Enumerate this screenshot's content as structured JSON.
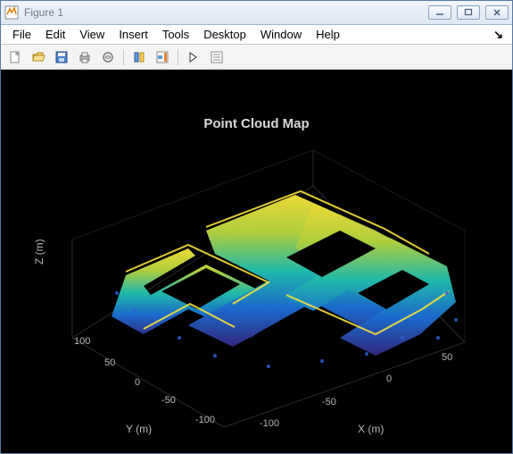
{
  "window": {
    "title": "Figure 1"
  },
  "menu": {
    "file": "File",
    "edit": "Edit",
    "view": "View",
    "insert": "Insert",
    "tools": "Tools",
    "desktop": "Desktop",
    "window": "Window",
    "help": "Help",
    "dock": "↘"
  },
  "chart_data": {
    "type": "3d-point-cloud",
    "title": "Point Cloud Map",
    "xlabel": "X (m)",
    "ylabel": "Y (m)",
    "zlabel": "Z (m)",
    "x_ticks": [
      -100,
      -50,
      0,
      50
    ],
    "y_ticks": [
      -100,
      -50,
      0,
      50,
      100
    ],
    "z_ticks": [],
    "xlim": [
      -120,
      80
    ],
    "ylim": [
      -120,
      130
    ],
    "zlim": [
      0,
      20
    ],
    "colormap": "parula",
    "note": "3D LIDAR-style point cloud of building floorplan; height encoded by color (blue low, yellow high). Values estimated from axis ticks."
  }
}
